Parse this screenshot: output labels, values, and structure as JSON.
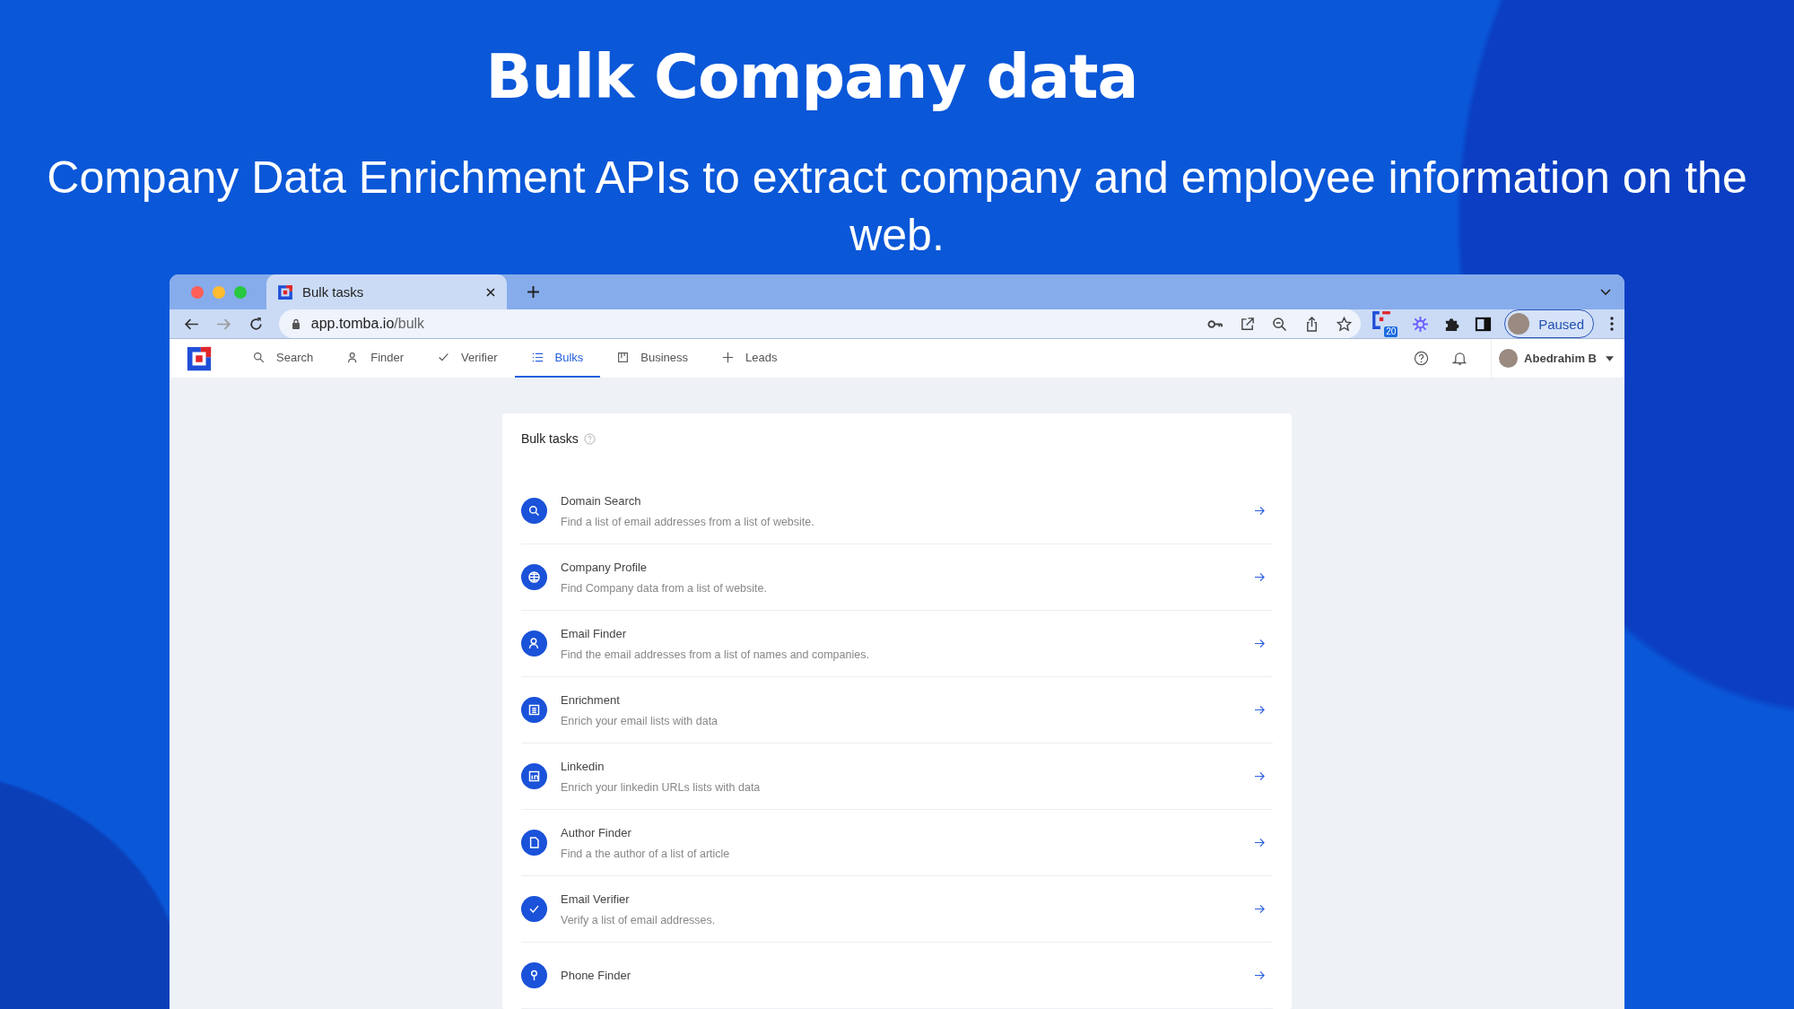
{
  "headline": "Bulk Company data",
  "subheadline": "Company Data Enrichment APIs to extract company and employee information on the web.",
  "browser": {
    "tab_title": "Bulk tasks",
    "url_host": "app.tomba.io",
    "url_path": "/bulk",
    "extension_badge": "20",
    "profile_status": "Paused"
  },
  "nav": {
    "items": [
      {
        "label": "Search",
        "selected": false
      },
      {
        "label": "Finder",
        "selected": false
      },
      {
        "label": "Verifier",
        "selected": false
      },
      {
        "label": "Bulks",
        "selected": true
      },
      {
        "label": "Business",
        "selected": false
      },
      {
        "label": "Leads",
        "selected": false
      }
    ],
    "user_name": "Abedrahim B"
  },
  "card": {
    "title": "Bulk tasks",
    "tasks": [
      {
        "title": "Domain Search",
        "description": "Find a list of email addresses from a list of website."
      },
      {
        "title": "Company Profile",
        "description": "Find Company data from a list of website."
      },
      {
        "title": "Email Finder",
        "description": "Find the email addresses from a list of names and companies."
      },
      {
        "title": "Enrichment",
        "description": "Enrich your email lists with data"
      },
      {
        "title": "Linkedin",
        "description": "Enrich your linkedin URLs lists with data"
      },
      {
        "title": "Author Finder",
        "description": "Find a the author of a list of article"
      },
      {
        "title": "Email Verifier",
        "description": "Verify a list of email addresses."
      },
      {
        "title": "Phone Finder"
      }
    ]
  }
}
